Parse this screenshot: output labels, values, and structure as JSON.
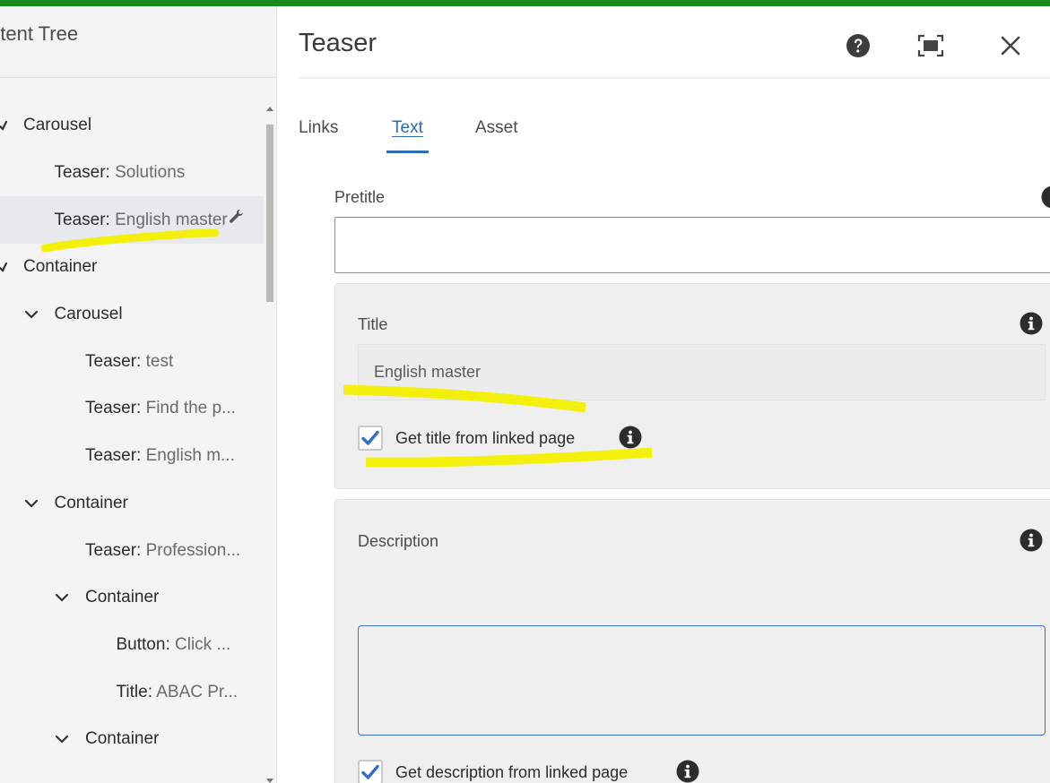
{
  "content_tree": {
    "title": "ntent Tree",
    "items": [
      {
        "type": "Carousel",
        "name": "",
        "sep": "",
        "level": 0,
        "chevron": "check",
        "selected": false,
        "wrench": false
      },
      {
        "type": "Teaser",
        "name": "Solutions",
        "sep": ": ",
        "level": 1,
        "chevron": "",
        "selected": false,
        "wrench": false
      },
      {
        "type": "Teaser",
        "name": "English master",
        "sep": ": ",
        "level": 1,
        "chevron": "",
        "selected": true,
        "wrench": true
      },
      {
        "type": "Container",
        "name": "",
        "sep": "",
        "level": 0,
        "chevron": "check",
        "selected": false,
        "wrench": false
      },
      {
        "type": "Carousel",
        "name": "",
        "sep": "",
        "level": 1,
        "chevron": "down",
        "selected": false,
        "wrench": false
      },
      {
        "type": "Teaser",
        "name": "test",
        "sep": ": ",
        "level": 2,
        "chevron": "",
        "selected": false,
        "wrench": false
      },
      {
        "type": "Teaser",
        "name": "Find the p...",
        "sep": ": ",
        "level": 2,
        "chevron": "",
        "selected": false,
        "wrench": false
      },
      {
        "type": "Teaser",
        "name": "English m...",
        "sep": ": ",
        "level": 2,
        "chevron": "",
        "selected": false,
        "wrench": false
      },
      {
        "type": "Container",
        "name": "",
        "sep": "",
        "level": 1,
        "chevron": "down",
        "selected": false,
        "wrench": false
      },
      {
        "type": "Teaser",
        "name": "Profession...",
        "sep": ": ",
        "level": 2,
        "chevron": "",
        "selected": false,
        "wrench": false
      },
      {
        "type": "Container",
        "name": "",
        "sep": "",
        "level": 2,
        "chevron": "down",
        "selected": false,
        "wrench": false
      },
      {
        "type": "Button",
        "name": "Click ...",
        "sep": ": ",
        "level": 3,
        "chevron": "",
        "selected": false,
        "wrench": false
      },
      {
        "type": "Title",
        "name": "ABAC Pr...",
        "sep": ": ",
        "level": 3,
        "chevron": "",
        "selected": false,
        "wrench": false
      },
      {
        "type": "Container",
        "name": "",
        "sep": "",
        "level": 2,
        "chevron": "down",
        "selected": false,
        "wrench": false
      }
    ]
  },
  "dialog": {
    "title": "Teaser",
    "tabs": [
      {
        "label": "Links",
        "active": false
      },
      {
        "label": "Text",
        "active": true
      },
      {
        "label": "Asset",
        "active": false
      }
    ],
    "pretitle": {
      "label": "Pretitle",
      "value": ""
    },
    "title_field": {
      "label": "Title",
      "value": "English master"
    },
    "title_checkbox": {
      "label": "Get title from linked page",
      "checked": true
    },
    "description": {
      "label": "Description",
      "value": ""
    },
    "description_checkbox": {
      "label": "Get description from linked page",
      "checked": true
    }
  },
  "colors": {
    "accent": "#2c6cb8",
    "top_bar": "#1b8a1b",
    "highlight": "#f3ef00",
    "selected_row": "#e7e9ef",
    "checkmark": "#2f6fc8"
  },
  "icons": {
    "help": "help-icon",
    "fullscreen": "fullscreen-icon",
    "close": "close-icon",
    "info": "info-icon",
    "wrench": "wrench-icon"
  }
}
